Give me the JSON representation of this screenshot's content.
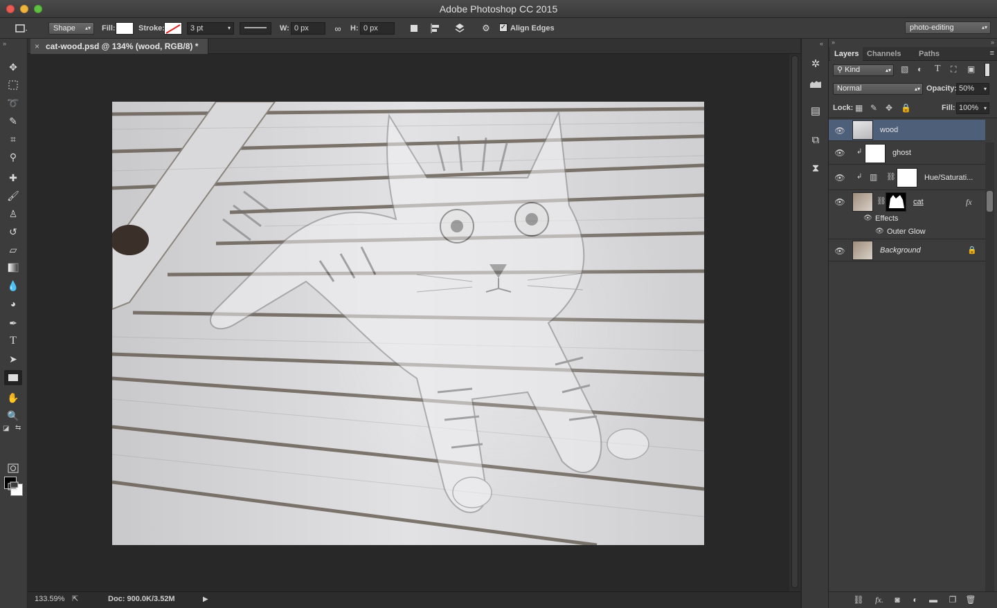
{
  "app": {
    "title": "Adobe Photoshop CC 2015"
  },
  "options_bar": {
    "tool_mode": "Shape",
    "fill_label": "Fill:",
    "stroke_label": "Stroke:",
    "stroke_width": "3 pt",
    "w_label": "W:",
    "w_value": "0 px",
    "h_label": "H:",
    "h_value": "0 px",
    "align_edges_label": "Align Edges",
    "align_edges_checked": true,
    "workspace": "photo-editing"
  },
  "document": {
    "tab_title": "cat-wood.psd @ 134% (wood, RGB/8) *"
  },
  "status": {
    "zoom": "133.59%",
    "doc_size": "Doc: 900.0K/3.52M"
  },
  "layers_panel": {
    "tabs": [
      "Layers",
      "Channels",
      "Paths"
    ],
    "active_tab": "Layers",
    "filter": "Kind",
    "blend_mode": "Normal",
    "opacity_label": "Opacity:",
    "opacity": "50%",
    "lock_label": "Lock:",
    "fill_label": "Fill:",
    "fill": "100%",
    "layers": [
      {
        "name": "wood",
        "selected": true,
        "visible": true
      },
      {
        "name": "ghost",
        "selected": false,
        "visible": true,
        "clipped": true
      },
      {
        "name": "Hue/Saturati...",
        "selected": false,
        "visible": true,
        "clipped": true
      },
      {
        "name": "cat",
        "selected": false,
        "visible": true,
        "effects_label": "Effects",
        "effect": "Outer Glow",
        "fx": "fx"
      },
      {
        "name": "Background",
        "selected": false,
        "visible": true,
        "locked": true
      }
    ]
  },
  "colors": {
    "selected_layer": "#4e5f7a",
    "foreground": "#000000",
    "background": "#ffffff"
  }
}
